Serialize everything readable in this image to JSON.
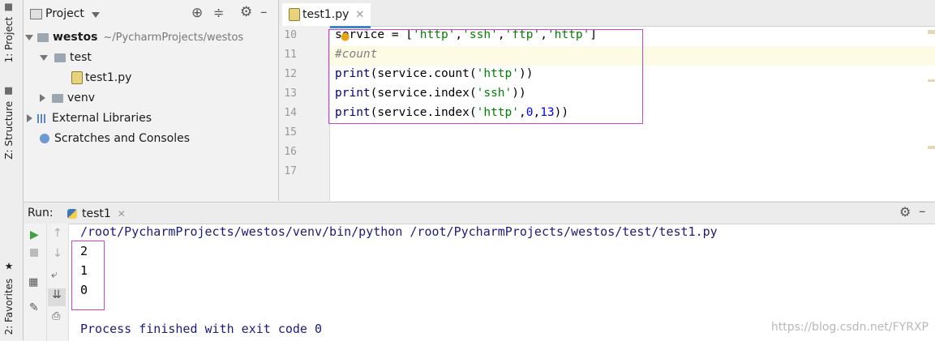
{
  "left_strip": {
    "project_tab": "1: Project",
    "structure_tab": "Z: Structure",
    "favorites_tab": "2: Favorites"
  },
  "project_panel": {
    "title": "Project",
    "tree": {
      "root_name": "westos",
      "root_path": "~/PycharmProjects/westos",
      "test_folder": "test",
      "test_file": "test1.py",
      "venv_folder": "venv",
      "external_libraries": "External Libraries",
      "scratches": "Scratches and Consoles"
    }
  },
  "editor": {
    "tab_label": "test1.py",
    "line_numbers": [
      "10",
      "11",
      "12",
      "13",
      "14",
      "15",
      "16",
      "17"
    ],
    "code": {
      "l10_a": "service = [",
      "l10_s1": "'http'",
      "l10_s2": "'ssh'",
      "l10_s3": "'ftp'",
      "l10_s4": "'http'",
      "l11": "#count",
      "l12_kw": "print",
      "l12_a": "(service.count(",
      "l12_s": "'http'",
      "l12_b": "))",
      "l13_kw": "print",
      "l13_a": "(service.index(",
      "l13_s": "'ssh'",
      "l13_b": "))",
      "l14_kw": "print",
      "l14_a": "(service.index(",
      "l14_s": "'http'",
      "l14_n1": "0",
      "l14_n2": "13",
      "l14_b": "))"
    }
  },
  "run_panel": {
    "label": "Run:",
    "config_tab": "test1",
    "command": "/root/PycharmProjects/westos/venv/bin/python /root/PycharmProjects/westos/test/test1.py",
    "outputs": [
      "2",
      "1",
      "0"
    ],
    "exit_message": "Process finished with exit code 0"
  },
  "watermark": "https://blog.csdn.net/FYRXP",
  "colors": {
    "highlight_box": "#cc44cc",
    "keyword": "#000080",
    "string": "#008000",
    "number": "#0000ff",
    "output_text": "#1a1a80"
  }
}
